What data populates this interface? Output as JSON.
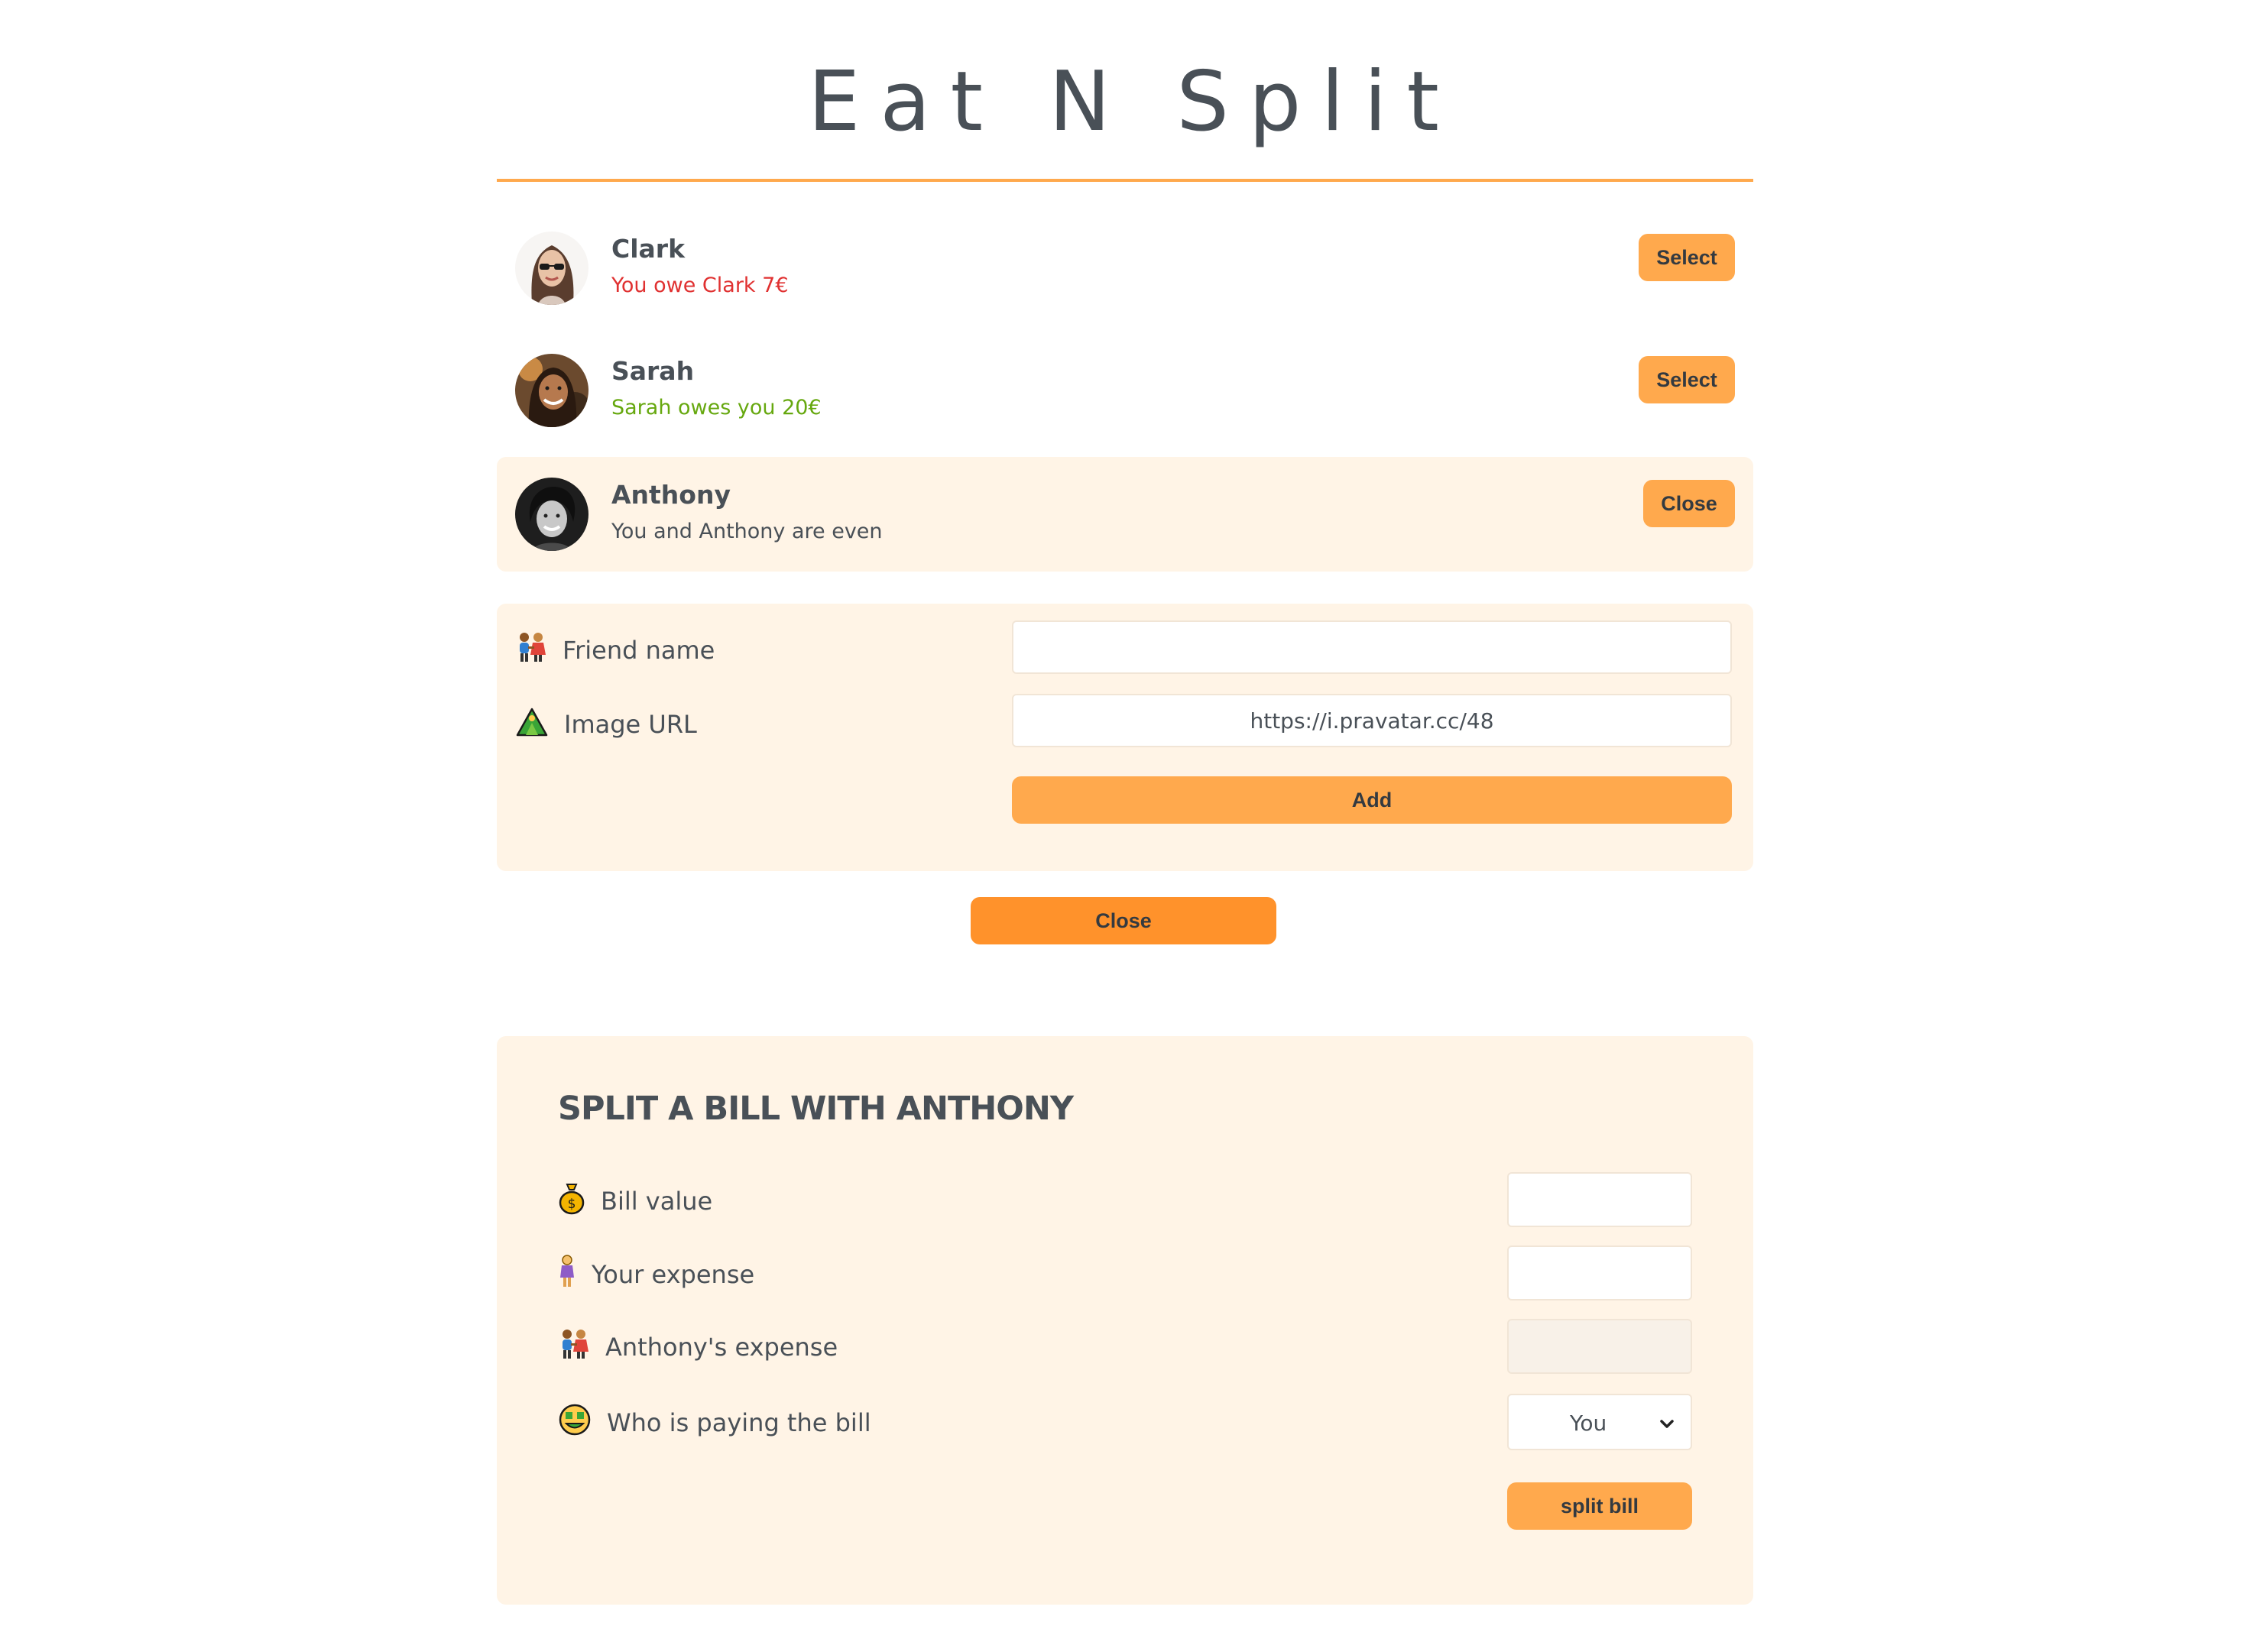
{
  "app": {
    "title": "Eat N Split"
  },
  "colors": {
    "accent": "#ffa94d",
    "accent_dark": "#ff922b",
    "panel": "#fff4e6",
    "owe": "#e03131",
    "owed": "#66a80f"
  },
  "friends": [
    {
      "name": "Clark",
      "balance_text": "You owe Clark 7€",
      "status": "owe",
      "button": "Select",
      "selected": false
    },
    {
      "name": "Sarah",
      "balance_text": "Sarah owes you 20€",
      "status": "owed",
      "button": "Select",
      "selected": false
    },
    {
      "name": "Anthony",
      "balance_text": "You and Anthony are even",
      "status": "even",
      "button": "Close",
      "selected": true
    }
  ],
  "add_friend_form": {
    "name_label": "Friend name",
    "name_icon": "people-holding-hands-icon",
    "name_value": "",
    "image_label": "Image URL",
    "image_icon": "mountain-picture-icon",
    "image_value": "https://i.pravatar.cc/48",
    "add_button": "Add"
  },
  "close_form_button": "Close",
  "split_form": {
    "title": "SPLIT A BILL WITH ANTHONY",
    "bill_label": "Bill value",
    "bill_icon": "money-bag-icon",
    "bill_value": "",
    "your_expense_label": "Your expense",
    "your_expense_icon": "woman-standing-icon",
    "your_expense_value": "",
    "friend_expense_label": "Anthony's expense",
    "friend_expense_icon": "people-holding-hands-icon",
    "friend_expense_value": "",
    "payer_label": "Who is paying the bill",
    "payer_icon": "money-mouth-face-icon",
    "payer_selected": "You",
    "submit_button": "split bill"
  }
}
